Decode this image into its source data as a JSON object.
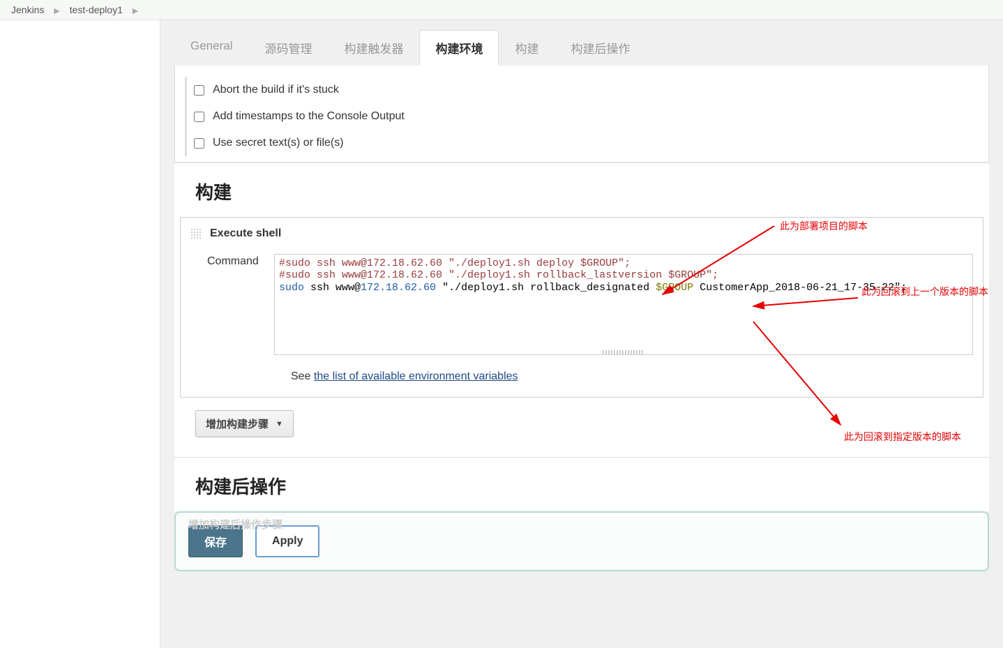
{
  "breadcrumbs": {
    "root": "Jenkins",
    "item": "test-deploy1"
  },
  "tabs": {
    "general": "General",
    "scm": "源码管理",
    "triggers": "构建触发器",
    "env": "构建环境",
    "build": "构建",
    "post": "构建后操作"
  },
  "env_checks": {
    "abort": "Abort the build if it's stuck",
    "timestamps": "Add timestamps to the Console Output",
    "secrets": "Use secret text(s) or file(s)"
  },
  "section_build": "构建",
  "exec_title": "Execute shell",
  "command_label": "Command",
  "code": {
    "line1_pre": "#sudo ssh www@172.18.62.60 \"./deploy1.sh deploy ",
    "line1_var": "$GROUP",
    "line1_post": "\";",
    "line2_pre": "#sudo ssh www@172.18.62.60 \"./deploy1.sh rollback_lastversion ",
    "line2_var": "$GROUP",
    "line2_post": "\";",
    "line3_kw": "sudo",
    "line3_a": " ssh www@",
    "line3_ip": "172.18.62.60",
    "line3_b": " \"./deploy1.sh rollback_designated ",
    "line3_var": "$GROUP",
    "line3_c": " CustomerApp_2018-06-21_17-35-22\";"
  },
  "see_text": "See ",
  "see_link": "the list of available environment variables",
  "add_step": "增加构建步骤",
  "section_post": "构建后操作",
  "ghost": "增加构建后操作步骤",
  "save": "保存",
  "apply": "Apply",
  "annotations": {
    "a1": "此为部署项目的脚本",
    "a2": "此为回滚到上一个版本的脚本",
    "a3": "此为回滚到指定版本的脚本"
  }
}
